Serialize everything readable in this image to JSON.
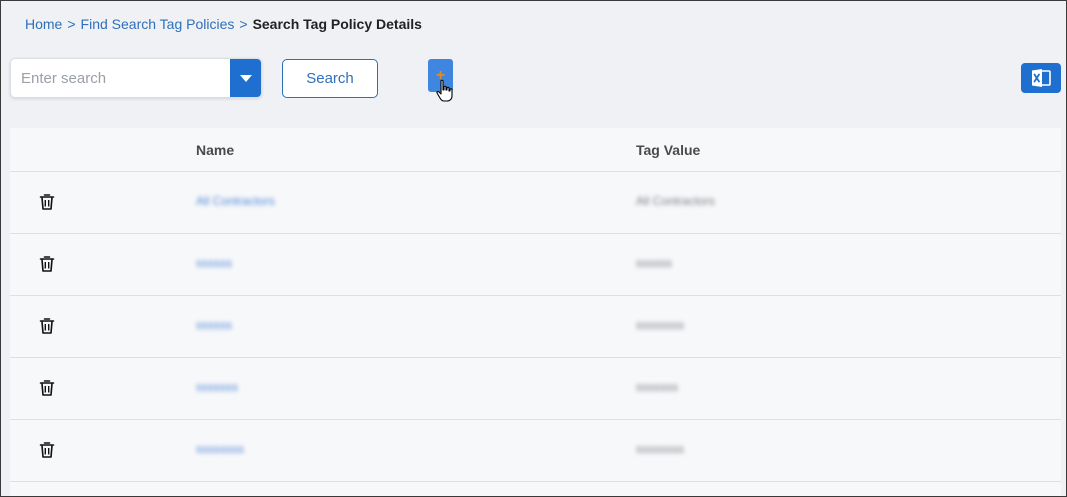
{
  "breadcrumb": {
    "home": "Home",
    "sep": ">",
    "parent": "Find Search Tag Policies",
    "current": "Search Tag Policy Details"
  },
  "search": {
    "placeholder": "Enter search",
    "value": "",
    "button_label": "Search",
    "dropdown_icon": "caret-down-icon"
  },
  "toolbar": {
    "add_label": "+",
    "excel_icon": "excel-icon"
  },
  "colors": {
    "accent": "#1f6fd1",
    "link": "#2f6fba",
    "add_plus": "#e08b2a",
    "background": "#eff1f5"
  },
  "table": {
    "headers": {
      "name": "Name",
      "tag_value": "Tag Value"
    },
    "rows": [
      {
        "name": "All Contractors",
        "tag_value": "All Contractors"
      },
      {
        "name": "ssssss",
        "tag_value": "ssssss"
      },
      {
        "name": "ssssss",
        "tag_value": "ssssssss"
      },
      {
        "name": "sssssss",
        "tag_value": "sssssss"
      },
      {
        "name": "ssssssss",
        "tag_value": "ssssssss"
      }
    ]
  }
}
